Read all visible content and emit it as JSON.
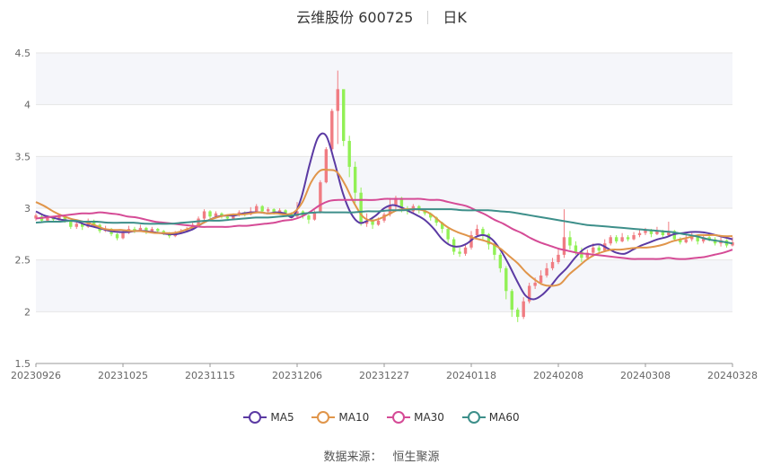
{
  "chart_data": {
    "type": "candlestick",
    "title": "云维股份 600725",
    "subtitle": "日K",
    "ylim": [
      1.5,
      4.5
    ],
    "y_ticks": [
      "1.5",
      "2",
      "2.5",
      "3",
      "3.5",
      "4",
      "4.5"
    ],
    "x_ticks": [
      "20230926",
      "20231025",
      "20231115",
      "20231206",
      "20231227",
      "20240118",
      "20240208",
      "20240308",
      "20240328"
    ],
    "n_days": 121,
    "colors": {
      "up": "#f07c82",
      "down": "#91f055",
      "grid": "#e6e6e6",
      "band": "#f5f6fa",
      "axis": "#999999"
    },
    "candles": [
      [
        2.9,
        2.93,
        2.95,
        2.88
      ],
      [
        2.92,
        2.88,
        2.94,
        2.86
      ],
      [
        2.88,
        2.91,
        2.93,
        2.87
      ],
      [
        2.91,
        2.89,
        2.92,
        2.87
      ],
      [
        2.89,
        2.92,
        2.94,
        2.88
      ],
      [
        2.92,
        2.88,
        2.93,
        2.86
      ],
      [
        2.88,
        2.82,
        2.89,
        2.8
      ],
      [
        2.82,
        2.85,
        2.87,
        2.8
      ],
      [
        2.85,
        2.82,
        2.86,
        2.79
      ],
      [
        2.82,
        2.88,
        2.9,
        2.81
      ],
      [
        2.88,
        2.84,
        2.89,
        2.82
      ],
      [
        2.84,
        2.78,
        2.85,
        2.76
      ],
      [
        2.78,
        2.8,
        2.83,
        2.77
      ],
      [
        2.8,
        2.75,
        2.81,
        2.73
      ],
      [
        2.75,
        2.71,
        2.76,
        2.69
      ],
      [
        2.71,
        2.76,
        2.78,
        2.7
      ],
      [
        2.76,
        2.8,
        2.83,
        2.75
      ],
      [
        2.8,
        2.78,
        2.82,
        2.76
      ],
      [
        2.78,
        2.81,
        2.84,
        2.77
      ],
      [
        2.81,
        2.77,
        2.82,
        2.75
      ],
      [
        2.77,
        2.8,
        2.82,
        2.76
      ],
      [
        2.8,
        2.78,
        2.81,
        2.76
      ],
      [
        2.78,
        2.76,
        2.79,
        2.74
      ],
      [
        2.76,
        2.73,
        2.77,
        2.71
      ],
      [
        2.73,
        2.76,
        2.78,
        2.72
      ],
      [
        2.76,
        2.78,
        2.8,
        2.75
      ],
      [
        2.78,
        2.8,
        2.82,
        2.77
      ],
      [
        2.8,
        2.84,
        2.86,
        2.79
      ],
      [
        2.84,
        2.9,
        2.92,
        2.83
      ],
      [
        2.9,
        2.97,
        2.99,
        2.88
      ],
      [
        2.97,
        2.92,
        2.98,
        2.9
      ],
      [
        2.92,
        2.95,
        2.97,
        2.91
      ],
      [
        2.95,
        2.92,
        2.96,
        2.9
      ],
      [
        2.92,
        2.9,
        2.93,
        2.88
      ],
      [
        2.9,
        2.93,
        2.95,
        2.89
      ],
      [
        2.93,
        2.96,
        2.98,
        2.92
      ],
      [
        2.96,
        2.94,
        2.97,
        2.92
      ],
      [
        2.94,
        2.97,
        3.01,
        2.93
      ],
      [
        2.97,
        3.02,
        3.04,
        2.96
      ],
      [
        3.02,
        2.97,
        3.03,
        2.95
      ],
      [
        2.97,
        2.99,
        3.01,
        2.96
      ],
      [
        2.99,
        2.96,
        3.0,
        2.94
      ],
      [
        2.96,
        2.98,
        3.0,
        2.95
      ],
      [
        2.98,
        2.95,
        2.99,
        2.93
      ],
      [
        2.95,
        2.92,
        2.96,
        2.9
      ],
      [
        2.92,
        2.97,
        3.06,
        2.91
      ],
      [
        2.97,
        2.93,
        2.98,
        2.9
      ],
      [
        2.93,
        2.89,
        2.94,
        2.85
      ],
      [
        2.89,
        2.96,
        2.98,
        2.88
      ],
      [
        2.96,
        3.25,
        3.27,
        2.95
      ],
      [
        3.25,
        3.57,
        3.59,
        3.24
      ],
      [
        3.57,
        3.94,
        3.96,
        3.55
      ],
      [
        3.94,
        4.15,
        4.33,
        3.62
      ],
      [
        4.15,
        3.65,
        4.0,
        3.6
      ],
      [
        3.65,
        3.4,
        3.7,
        3.3
      ],
      [
        3.4,
        3.15,
        3.45,
        3.05
      ],
      [
        3.15,
        2.85,
        3.2,
        2.83
      ],
      [
        2.85,
        2.88,
        2.95,
        2.82
      ],
      [
        2.88,
        2.84,
        2.92,
        2.8
      ],
      [
        2.84,
        2.88,
        2.91,
        2.83
      ],
      [
        2.88,
        2.94,
        2.96,
        2.86
      ],
      [
        2.94,
        3.02,
        3.1,
        2.92
      ],
      [
        3.02,
        3.1,
        3.12,
        2.98
      ],
      [
        3.1,
        3.0,
        3.11,
        2.96
      ],
      [
        3.0,
        2.97,
        3.02,
        2.94
      ],
      [
        2.97,
        3.02,
        3.04,
        2.95
      ],
      [
        3.02,
        2.98,
        3.03,
        2.95
      ],
      [
        2.98,
        2.95,
        2.99,
        2.93
      ],
      [
        2.95,
        2.91,
        2.96,
        2.88
      ],
      [
        2.91,
        2.86,
        2.92,
        2.83
      ],
      [
        2.86,
        2.8,
        2.87,
        2.76
      ],
      [
        2.8,
        2.7,
        2.82,
        2.65
      ],
      [
        2.7,
        2.58,
        2.72,
        2.55
      ],
      [
        2.58,
        2.56,
        2.62,
        2.53
      ],
      [
        2.56,
        2.62,
        2.65,
        2.54
      ],
      [
        2.62,
        2.74,
        2.78,
        2.6
      ],
      [
        2.74,
        2.8,
        2.84,
        2.72
      ],
      [
        2.8,
        2.75,
        2.82,
        2.7
      ],
      [
        2.75,
        2.65,
        2.76,
        2.6
      ],
      [
        2.65,
        2.55,
        2.67,
        2.5
      ],
      [
        2.55,
        2.42,
        2.57,
        2.38
      ],
      [
        2.42,
        2.2,
        2.44,
        2.12
      ],
      [
        2.2,
        2.02,
        2.22,
        1.95
      ],
      [
        2.02,
        1.95,
        2.04,
        1.9
      ],
      [
        1.95,
        2.1,
        2.14,
        1.93
      ],
      [
        2.1,
        2.25,
        2.28,
        2.08
      ],
      [
        2.25,
        2.28,
        2.33,
        2.22
      ],
      [
        2.28,
        2.35,
        2.4,
        2.26
      ],
      [
        2.35,
        2.42,
        2.47,
        2.33
      ],
      [
        2.42,
        2.48,
        2.52,
        2.4
      ],
      [
        2.48,
        2.55,
        2.6,
        2.46
      ],
      [
        2.55,
        2.72,
        2.99,
        2.52
      ],
      [
        2.72,
        2.64,
        2.78,
        2.6
      ],
      [
        2.64,
        2.58,
        2.68,
        2.55
      ],
      [
        2.58,
        2.52,
        2.62,
        2.48
      ],
      [
        2.52,
        2.57,
        2.6,
        2.5
      ],
      [
        2.57,
        2.62,
        2.66,
        2.55
      ],
      [
        2.62,
        2.59,
        2.64,
        2.57
      ],
      [
        2.59,
        2.66,
        2.7,
        2.58
      ],
      [
        2.66,
        2.72,
        2.74,
        2.64
      ],
      [
        2.72,
        2.68,
        2.74,
        2.66
      ],
      [
        2.68,
        2.72,
        2.76,
        2.67
      ],
      [
        2.72,
        2.7,
        2.74,
        2.68
      ],
      [
        2.7,
        2.74,
        2.77,
        2.69
      ],
      [
        2.74,
        2.76,
        2.79,
        2.72
      ],
      [
        2.76,
        2.79,
        2.81,
        2.74
      ],
      [
        2.79,
        2.75,
        2.8,
        2.72
      ],
      [
        2.75,
        2.78,
        2.82,
        2.74
      ],
      [
        2.78,
        2.74,
        2.79,
        2.72
      ],
      [
        2.74,
        2.78,
        2.87,
        2.73
      ],
      [
        2.78,
        2.7,
        2.79,
        2.68
      ],
      [
        2.7,
        2.67,
        2.72,
        2.65
      ],
      [
        2.67,
        2.7,
        2.74,
        2.66
      ],
      [
        2.7,
        2.73,
        2.76,
        2.68
      ],
      [
        2.73,
        2.68,
        2.74,
        2.65
      ],
      [
        2.68,
        2.72,
        2.75,
        2.66
      ],
      [
        2.72,
        2.7,
        2.74,
        2.68
      ],
      [
        2.7,
        2.66,
        2.72,
        2.64
      ],
      [
        2.66,
        2.69,
        2.72,
        2.63
      ],
      [
        2.69,
        2.64,
        2.7,
        2.62
      ],
      [
        2.64,
        2.67,
        2.72,
        2.63
      ]
    ],
    "series": [
      {
        "name": "MA5",
        "color": "#5b3aa3",
        "values": [
          2.97,
          2.93,
          2.91,
          2.89,
          2.88,
          2.87,
          2.84,
          2.82,
          2.8,
          2.78,
          2.77,
          2.77,
          2.78,
          2.78,
          2.77,
          2.76,
          2.75,
          2.75,
          2.77,
          2.8,
          2.85,
          2.89,
          2.92,
          2.93,
          2.93,
          2.95,
          2.96,
          2.96,
          2.95,
          2.96,
          2.95,
          2.92,
          3.1,
          3.42,
          3.68,
          3.7,
          3.45,
          3.15,
          2.95,
          2.86,
          2.88,
          2.93,
          3.0,
          3.03,
          3.01,
          2.97,
          2.93,
          2.88,
          2.8,
          2.7,
          2.64,
          2.63,
          2.66,
          2.72,
          2.74,
          2.7,
          2.6,
          2.46,
          2.3,
          2.16,
          2.12,
          2.16,
          2.24,
          2.34,
          2.42,
          2.52,
          2.6,
          2.64,
          2.65,
          2.61,
          2.57,
          2.56,
          2.6,
          2.64,
          2.67,
          2.7,
          2.72,
          2.75,
          2.76,
          2.77,
          2.77,
          2.76,
          2.74,
          2.72,
          2.7
        ]
      },
      {
        "name": "MA10",
        "color": "#e0954a",
        "values": [
          3.06,
          3.02,
          2.97,
          2.93,
          2.9,
          2.88,
          2.86,
          2.83,
          2.8,
          2.79,
          2.79,
          2.78,
          2.78,
          2.77,
          2.76,
          2.76,
          2.76,
          2.78,
          2.81,
          2.84,
          2.88,
          2.91,
          2.93,
          2.94,
          2.94,
          2.95,
          2.96,
          2.95,
          2.95,
          2.94,
          2.96,
          3.06,
          3.25,
          3.36,
          3.37,
          3.35,
          3.22,
          3.05,
          2.92,
          2.88,
          2.9,
          2.94,
          2.98,
          2.99,
          2.99,
          2.98,
          2.94,
          2.87,
          2.81,
          2.77,
          2.74,
          2.71,
          2.69,
          2.66,
          2.61,
          2.54,
          2.47,
          2.38,
          2.31,
          2.26,
          2.25,
          2.27,
          2.36,
          2.43,
          2.5,
          2.55,
          2.58,
          2.6,
          2.6,
          2.61,
          2.62,
          2.62,
          2.63,
          2.65,
          2.68,
          2.7,
          2.72,
          2.74,
          2.74,
          2.74,
          2.73,
          2.73
        ]
      },
      {
        "name": "MA30",
        "color": "#d54b96",
        "values": [
          2.9,
          2.91,
          2.92,
          2.93,
          2.94,
          2.95,
          2.95,
          2.96,
          2.95,
          2.94,
          2.92,
          2.91,
          2.89,
          2.87,
          2.86,
          2.85,
          2.84,
          2.83,
          2.82,
          2.82,
          2.82,
          2.82,
          2.83,
          2.83,
          2.84,
          2.85,
          2.86,
          2.88,
          2.89,
          2.92,
          2.97,
          3.03,
          3.07,
          3.08,
          3.08,
          3.08,
          3.08,
          3.08,
          3.09,
          3.09,
          3.09,
          3.09,
          3.09,
          3.08,
          3.08,
          3.06,
          3.04,
          3.02,
          2.98,
          2.94,
          2.89,
          2.85,
          2.8,
          2.76,
          2.71,
          2.67,
          2.64,
          2.61,
          2.59,
          2.57,
          2.56,
          2.55,
          2.54,
          2.53,
          2.52,
          2.51,
          2.51,
          2.51,
          2.51,
          2.52,
          2.51,
          2.51,
          2.52,
          2.53,
          2.55,
          2.57,
          2.6
        ]
      },
      {
        "name": "MA60",
        "color": "#3d8f8a",
        "values": [
          2.86,
          2.87,
          2.87,
          2.88,
          2.87,
          2.87,
          2.86,
          2.86,
          2.86,
          2.85,
          2.85,
          2.85,
          2.86,
          2.87,
          2.88,
          2.88,
          2.89,
          2.9,
          2.91,
          2.91,
          2.92,
          2.93,
          2.95,
          2.96,
          2.96,
          2.96,
          2.96,
          2.97,
          2.97,
          2.98,
          2.98,
          2.99,
          2.99,
          2.99,
          2.99,
          2.98,
          2.98,
          2.98,
          2.97,
          2.96,
          2.94,
          2.92,
          2.9,
          2.88,
          2.86,
          2.84,
          2.83,
          2.82,
          2.81,
          2.8,
          2.79,
          2.78,
          2.77,
          2.75,
          2.73,
          2.7,
          2.68,
          2.66
        ]
      }
    ]
  },
  "legend": {
    "ma5": "MA5",
    "ma10": "MA10",
    "ma30": "MA30",
    "ma60": "MA60"
  },
  "source": {
    "label": "数据来源：",
    "value": "恒生聚源"
  }
}
